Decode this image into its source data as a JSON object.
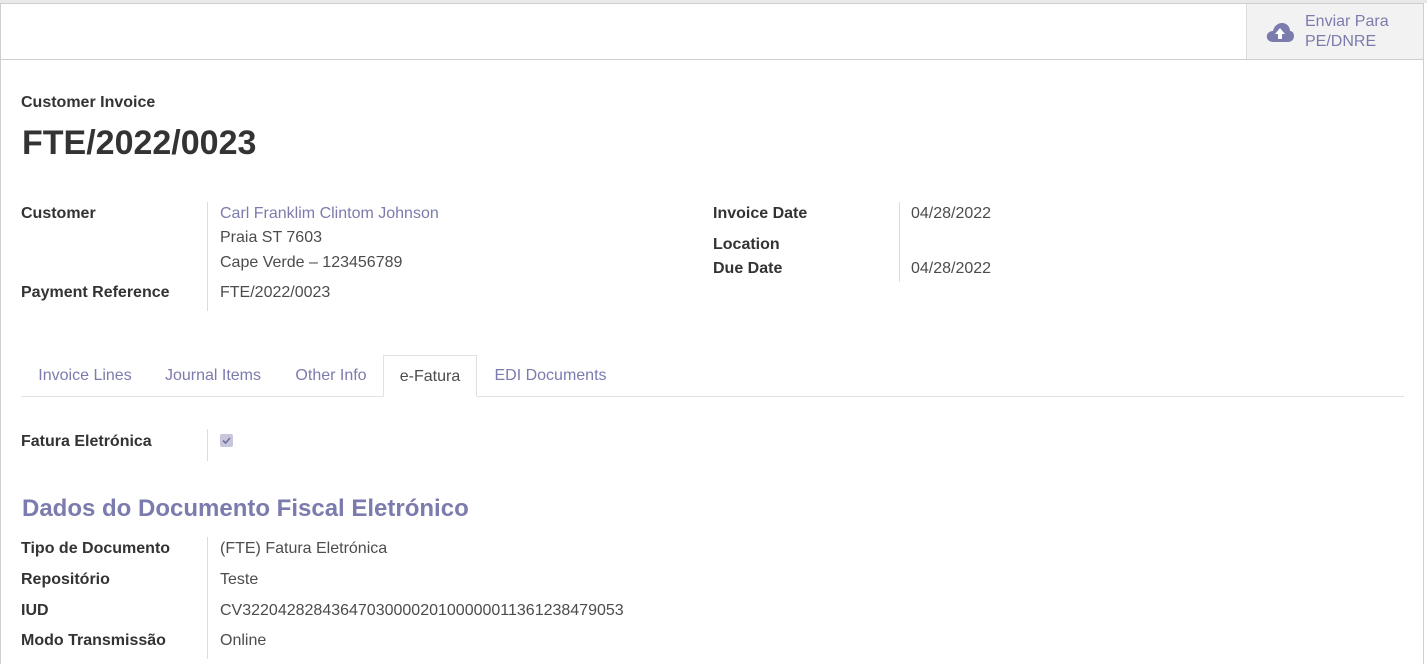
{
  "header": {
    "edi_button_label_1": "Enviar Para",
    "edi_button_label_2": "PE/DNRE",
    "edi_button_icon": "cloud-upload-icon"
  },
  "invoice": {
    "type_label": "Customer Invoice",
    "number": "FTE/2022/0023"
  },
  "fields": {
    "customer_label": "Customer",
    "customer_name": "Carl Franklim Clintom Johnson",
    "customer_addr1": "Praia ST 7603",
    "customer_addr2": "Cape Verde – 123456789",
    "payment_ref_label": "Payment Reference",
    "payment_ref": "FTE/2022/0023",
    "invoice_date_label": "Invoice Date",
    "invoice_date": "04/28/2022",
    "location_label": "Location",
    "due_date_label": "Due Date",
    "due_date": "04/28/2022"
  },
  "tabs": [
    {
      "label": "Invoice Lines"
    },
    {
      "label": "Journal Items"
    },
    {
      "label": "Other Info"
    },
    {
      "label": "e-Fatura"
    },
    {
      "label": "EDI Documents"
    }
  ],
  "efatura": {
    "fatura_label": "Fatura Eletrónica",
    "fatura_checked": true,
    "section_title": "Dados do Documento Fiscal Eletrónico",
    "tipo_label": "Tipo de Documento",
    "tipo": "(FTE) Fatura Eletrónica",
    "repo_label": "Repositório",
    "repo": "Teste",
    "iud_label": "IUD",
    "iud": "CV322042828436470300002010000001136123847905​3",
    "modo_label": "Modo Transmissão",
    "modo": "Online"
  },
  "colors": {
    "accent": "#7c7bad",
    "text": "#4c4c4c"
  }
}
